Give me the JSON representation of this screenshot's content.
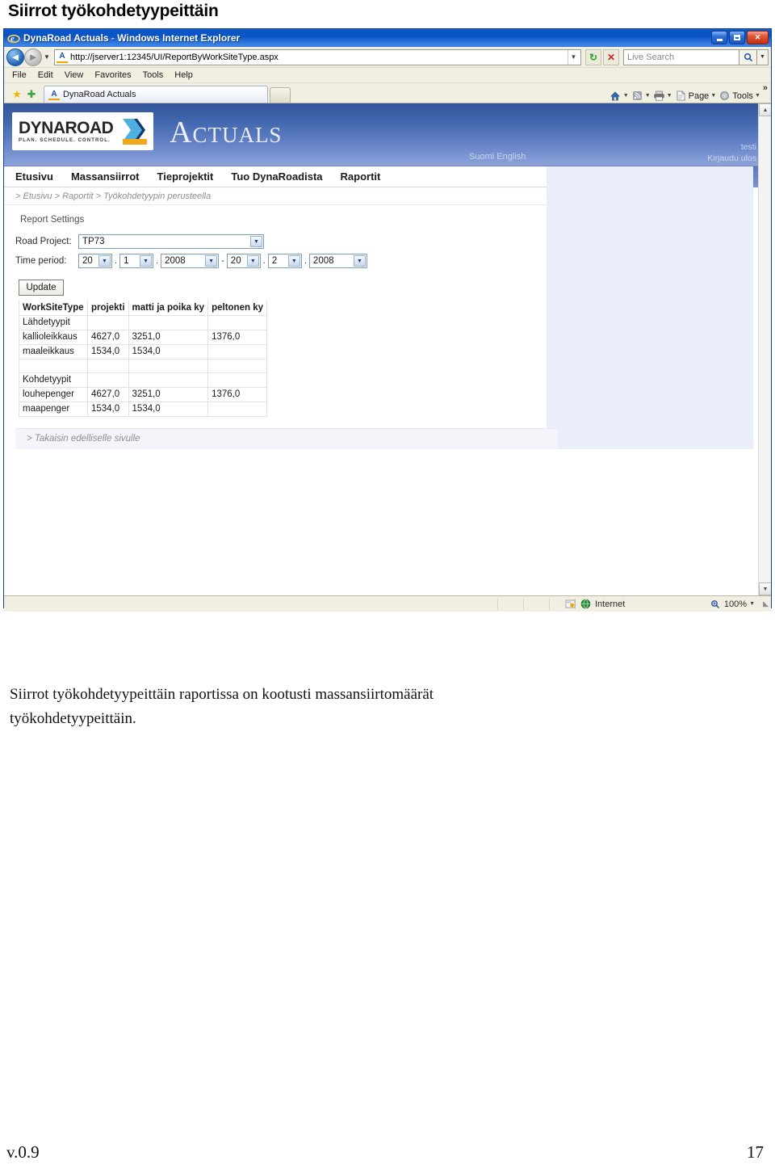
{
  "document": {
    "heading": "Siirrot työkohdetyypeittäin",
    "caption": "Siirrot työkohdetyypeittäin raportissa on kootusti massansiirtomäärät työkohdetyypeittäin.",
    "footer_version": "v.0.9",
    "footer_page": "17"
  },
  "browser": {
    "title_app": "DynaRoad Actuals",
    "title_sep": " - ",
    "title_suffix": "Windows Internet Explorer",
    "window_buttons": {
      "minimize": "minimize-icon",
      "restore": "restore-icon",
      "close": "✕"
    },
    "url": "http://jserver1:12345/UI/ReportByWorkSiteType.aspx",
    "url_favicon_letter": "A",
    "refresh_glyph": "↻",
    "stop_glyph": "✕",
    "search_placeholder": "Live Search",
    "search_go_glyph": "🔍",
    "menu": [
      "File",
      "Edit",
      "View",
      "Favorites",
      "Tools",
      "Help"
    ],
    "tab_title": "DynaRoad Actuals",
    "tab_favicon_letter": "A",
    "toolbar_right": [
      {
        "name": "home-icon",
        "glyph": "⌂",
        "label": ""
      },
      {
        "name": "feeds-icon",
        "glyph": "◉",
        "label": ""
      },
      {
        "name": "print-icon",
        "glyph": "⎙",
        "label": ""
      },
      {
        "name": "page-menu",
        "glyph": "📄",
        "label": "Page"
      },
      {
        "name": "tools-menu",
        "glyph": "⚙",
        "label": "Tools"
      }
    ],
    "overflow_glyph": "»",
    "status_zone": "Internet",
    "status_zoom": "100%",
    "status_zoom_glyph": "🔍",
    "scroll_up_glyph": "▲",
    "scroll_down_glyph": "▼"
  },
  "app": {
    "logo_word": "DYNAROAD",
    "logo_tagline": "PLAN. SCHEDULE. CONTROL.",
    "product_word": "Actuals",
    "lang_links": "Suomi English",
    "user_name": "testi",
    "logout_label": "Kirjaudu ulos",
    "nav_items": [
      "Etusivu",
      "Massansiirrot",
      "Tieprojektit",
      "Tuo DynaRoadista",
      "Raportit"
    ],
    "breadcrumb": "> Etusivu  > Raportit  > Työkohdetyypin perusteella",
    "report_settings_title": "Report Settings",
    "road_project_label": "Road Project:",
    "road_project_value": "TP73",
    "time_period_label": "Time period:",
    "time_period": {
      "from_day": "20",
      "from_month": "1",
      "from_year": "2008",
      "range_sep": "-",
      "to_day": "20",
      "to_month": "2",
      "to_year": "2008",
      "dot": "."
    },
    "update_label": "Update",
    "back_link": "> Takaisin edelliselle sivulle",
    "caret_glyph": "▼"
  },
  "table": {
    "headers": [
      "WorkSiteType",
      "projekti",
      "matti ja poika ky",
      "peltonen ky"
    ],
    "rows": [
      {
        "cells": [
          "Lähdetyypit",
          "",
          "",
          ""
        ]
      },
      {
        "cells": [
          "kallioleikkaus",
          "4627,0",
          "3251,0",
          "1376,0"
        ]
      },
      {
        "cells": [
          "maaleikkaus",
          "1534,0",
          "1534,0",
          ""
        ]
      },
      {
        "cells": [
          "",
          "",
          "",
          ""
        ]
      },
      {
        "cells": [
          "Kohdetyypit",
          "",
          "",
          ""
        ]
      },
      {
        "cells": [
          "louhepenger",
          "4627,0",
          "3251,0",
          "1376,0"
        ]
      },
      {
        "cells": [
          "maapenger",
          "1534,0",
          "1534,0",
          ""
        ]
      }
    ]
  },
  "colors": {
    "title_bar_blue": "#0a55c5",
    "app_header_blue": "#4267ae",
    "chrome_beige": "#f1efe2",
    "right_fill": "#e9eefa",
    "logo_orange": "#f3a81c"
  }
}
